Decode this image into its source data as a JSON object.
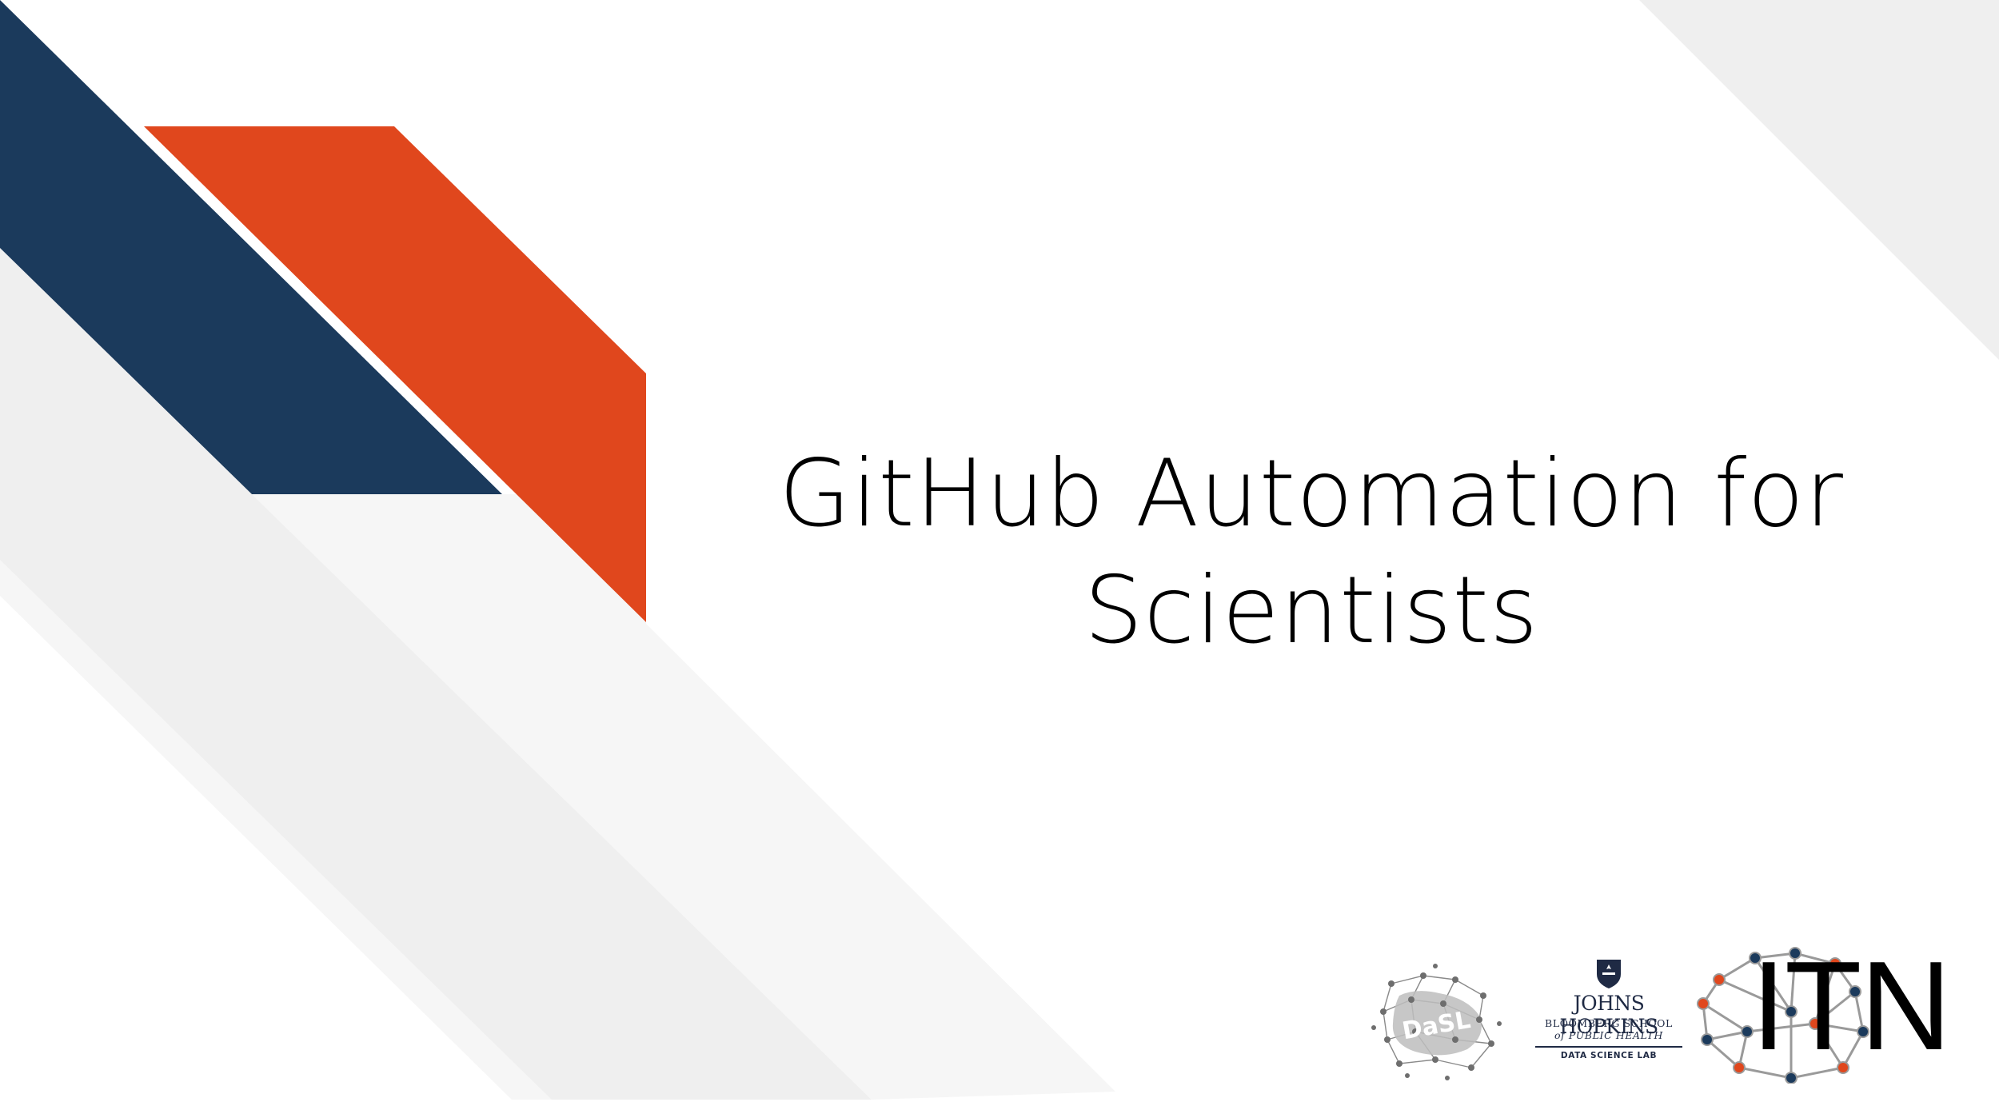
{
  "slide": {
    "title_line1": "GitHub Automation for",
    "title_line2": "Scientists"
  },
  "logos": {
    "dasl_logo_letters": "DaSL",
    "jh_name": "JOHNS HOPKINS",
    "jh_school_line1": "BLOOMBERG SCHOOL",
    "jh_school_line2": "of PUBLIC HEALTH",
    "jh_lab": "DATA SCIENCE LAB",
    "itn": "ITN"
  },
  "colors": {
    "navy": "#1b3a5c",
    "orange": "#e0471d",
    "light_gray": "#efefef",
    "lighter_gray": "#f6f6f6"
  }
}
